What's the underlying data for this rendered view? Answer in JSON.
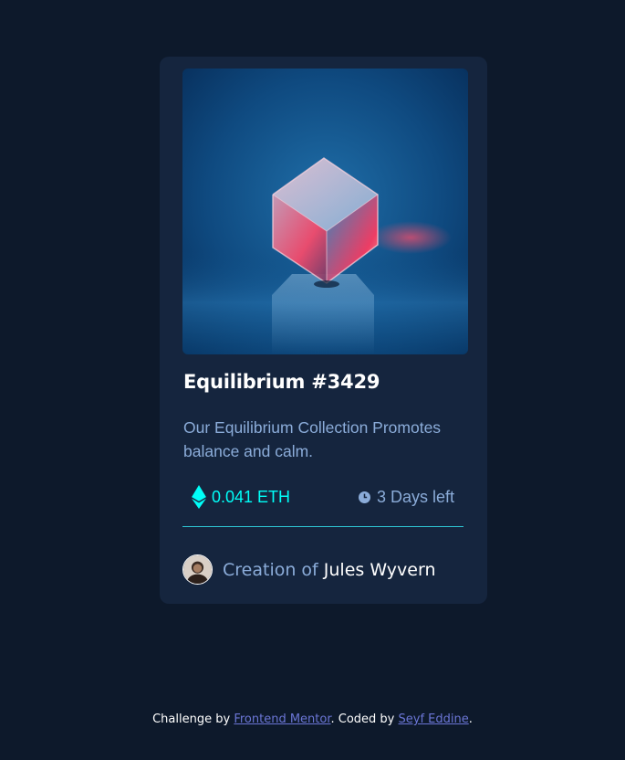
{
  "card": {
    "image_alt": "Equilibrium cube",
    "title": "Equilibrium #3429",
    "description": "Our Equilibrium Collection Promotes balance and calm.",
    "price": "0.041 ETH",
    "time_left": "3 Days left",
    "creator_prefix": "Creation of ",
    "creator_name": "Jules Wyvern"
  },
  "footer": {
    "challenge_prefix": "Challenge by ",
    "challenge_link": "Frontend Mentor",
    "coded_prefix": ". Coded by ",
    "author_link": "Seyf Eddine",
    "suffix": "."
  },
  "colors": {
    "page_bg": "#0d192b",
    "card_bg": "#15253e",
    "cyan": "#00fff8",
    "soft_blue": "#8bacd9",
    "link": "#6b76d6"
  },
  "icons": [
    "ethereum-icon",
    "clock-icon"
  ]
}
